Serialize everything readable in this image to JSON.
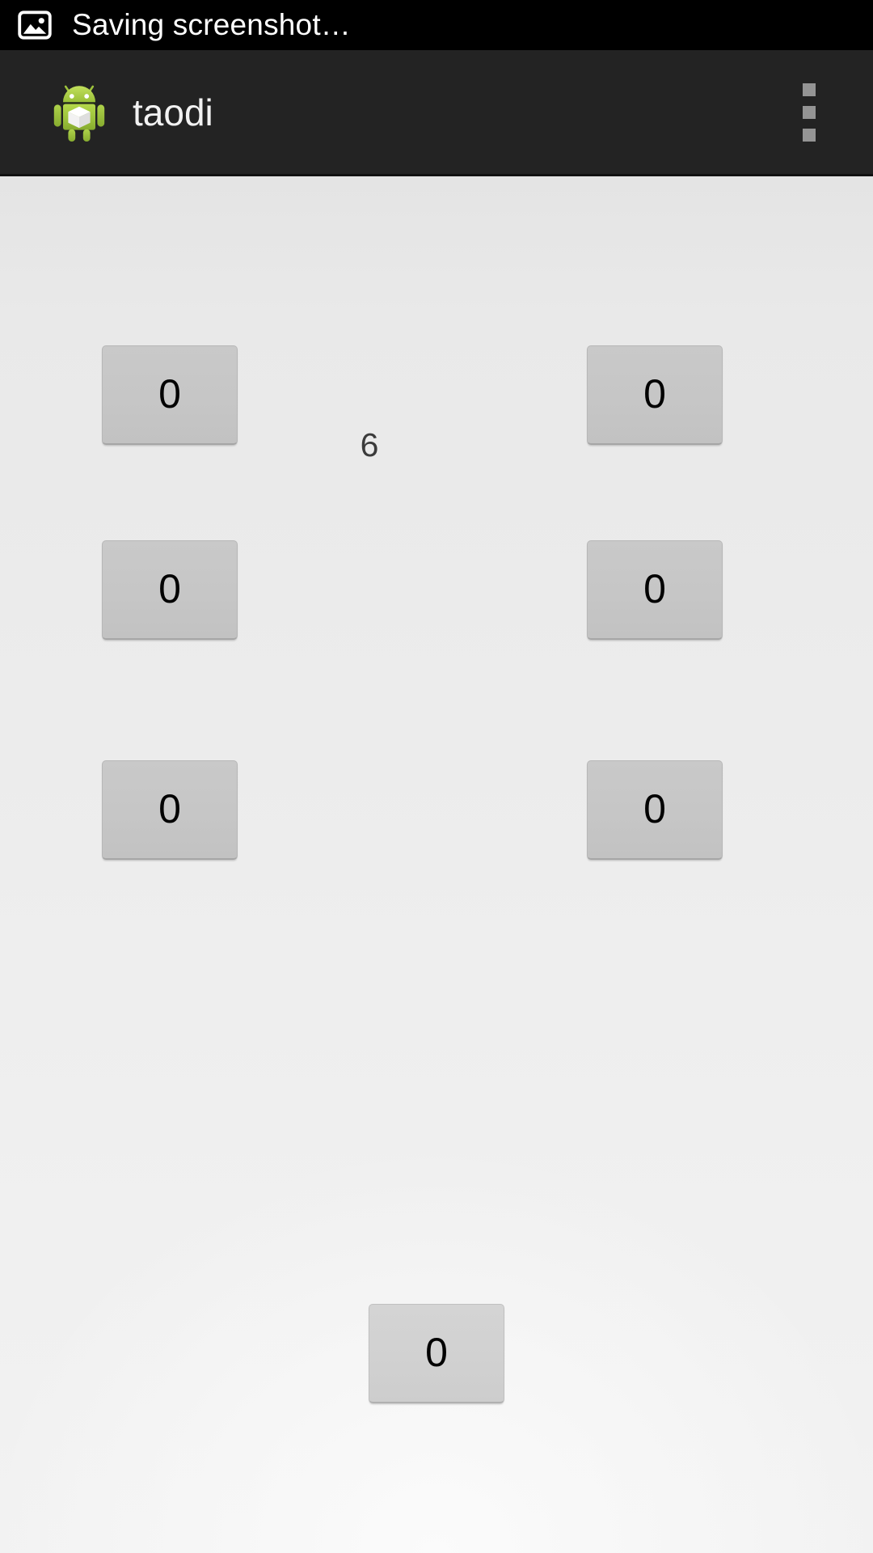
{
  "status_bar": {
    "icon": "image-icon",
    "text": "Saving screenshot…",
    "background": "#000000",
    "text_color": "#ffffff"
  },
  "action_bar": {
    "app_icon": "android-robot-icon",
    "title": "taodi",
    "overflow_menu": "overflow-menu-icon",
    "background": "#232323",
    "title_color": "#f2f2f2",
    "dot_color": "#949494"
  },
  "content": {
    "counter_label": "6",
    "counter_color": "#3b3b3b",
    "background_top": "#e4e4e4",
    "background_bottom": "#f2f2f2",
    "button_face": "#c6c6c6",
    "button_text_color": "#000000",
    "grid_buttons": [
      {
        "id": "button-r1c1",
        "label": "0",
        "row": 1,
        "col": "left"
      },
      {
        "id": "button-r1c2",
        "label": "0",
        "row": 1,
        "col": "right"
      },
      {
        "id": "button-r2c1",
        "label": "0",
        "row": 2,
        "col": "left"
      },
      {
        "id": "button-r2c2",
        "label": "0",
        "row": 2,
        "col": "right"
      },
      {
        "id": "button-r3c1",
        "label": "0",
        "row": 3,
        "col": "left"
      },
      {
        "id": "button-r3c2",
        "label": "0",
        "row": 3,
        "col": "right"
      }
    ],
    "bottom_button": {
      "id": "button-bottom",
      "label": "0"
    }
  }
}
